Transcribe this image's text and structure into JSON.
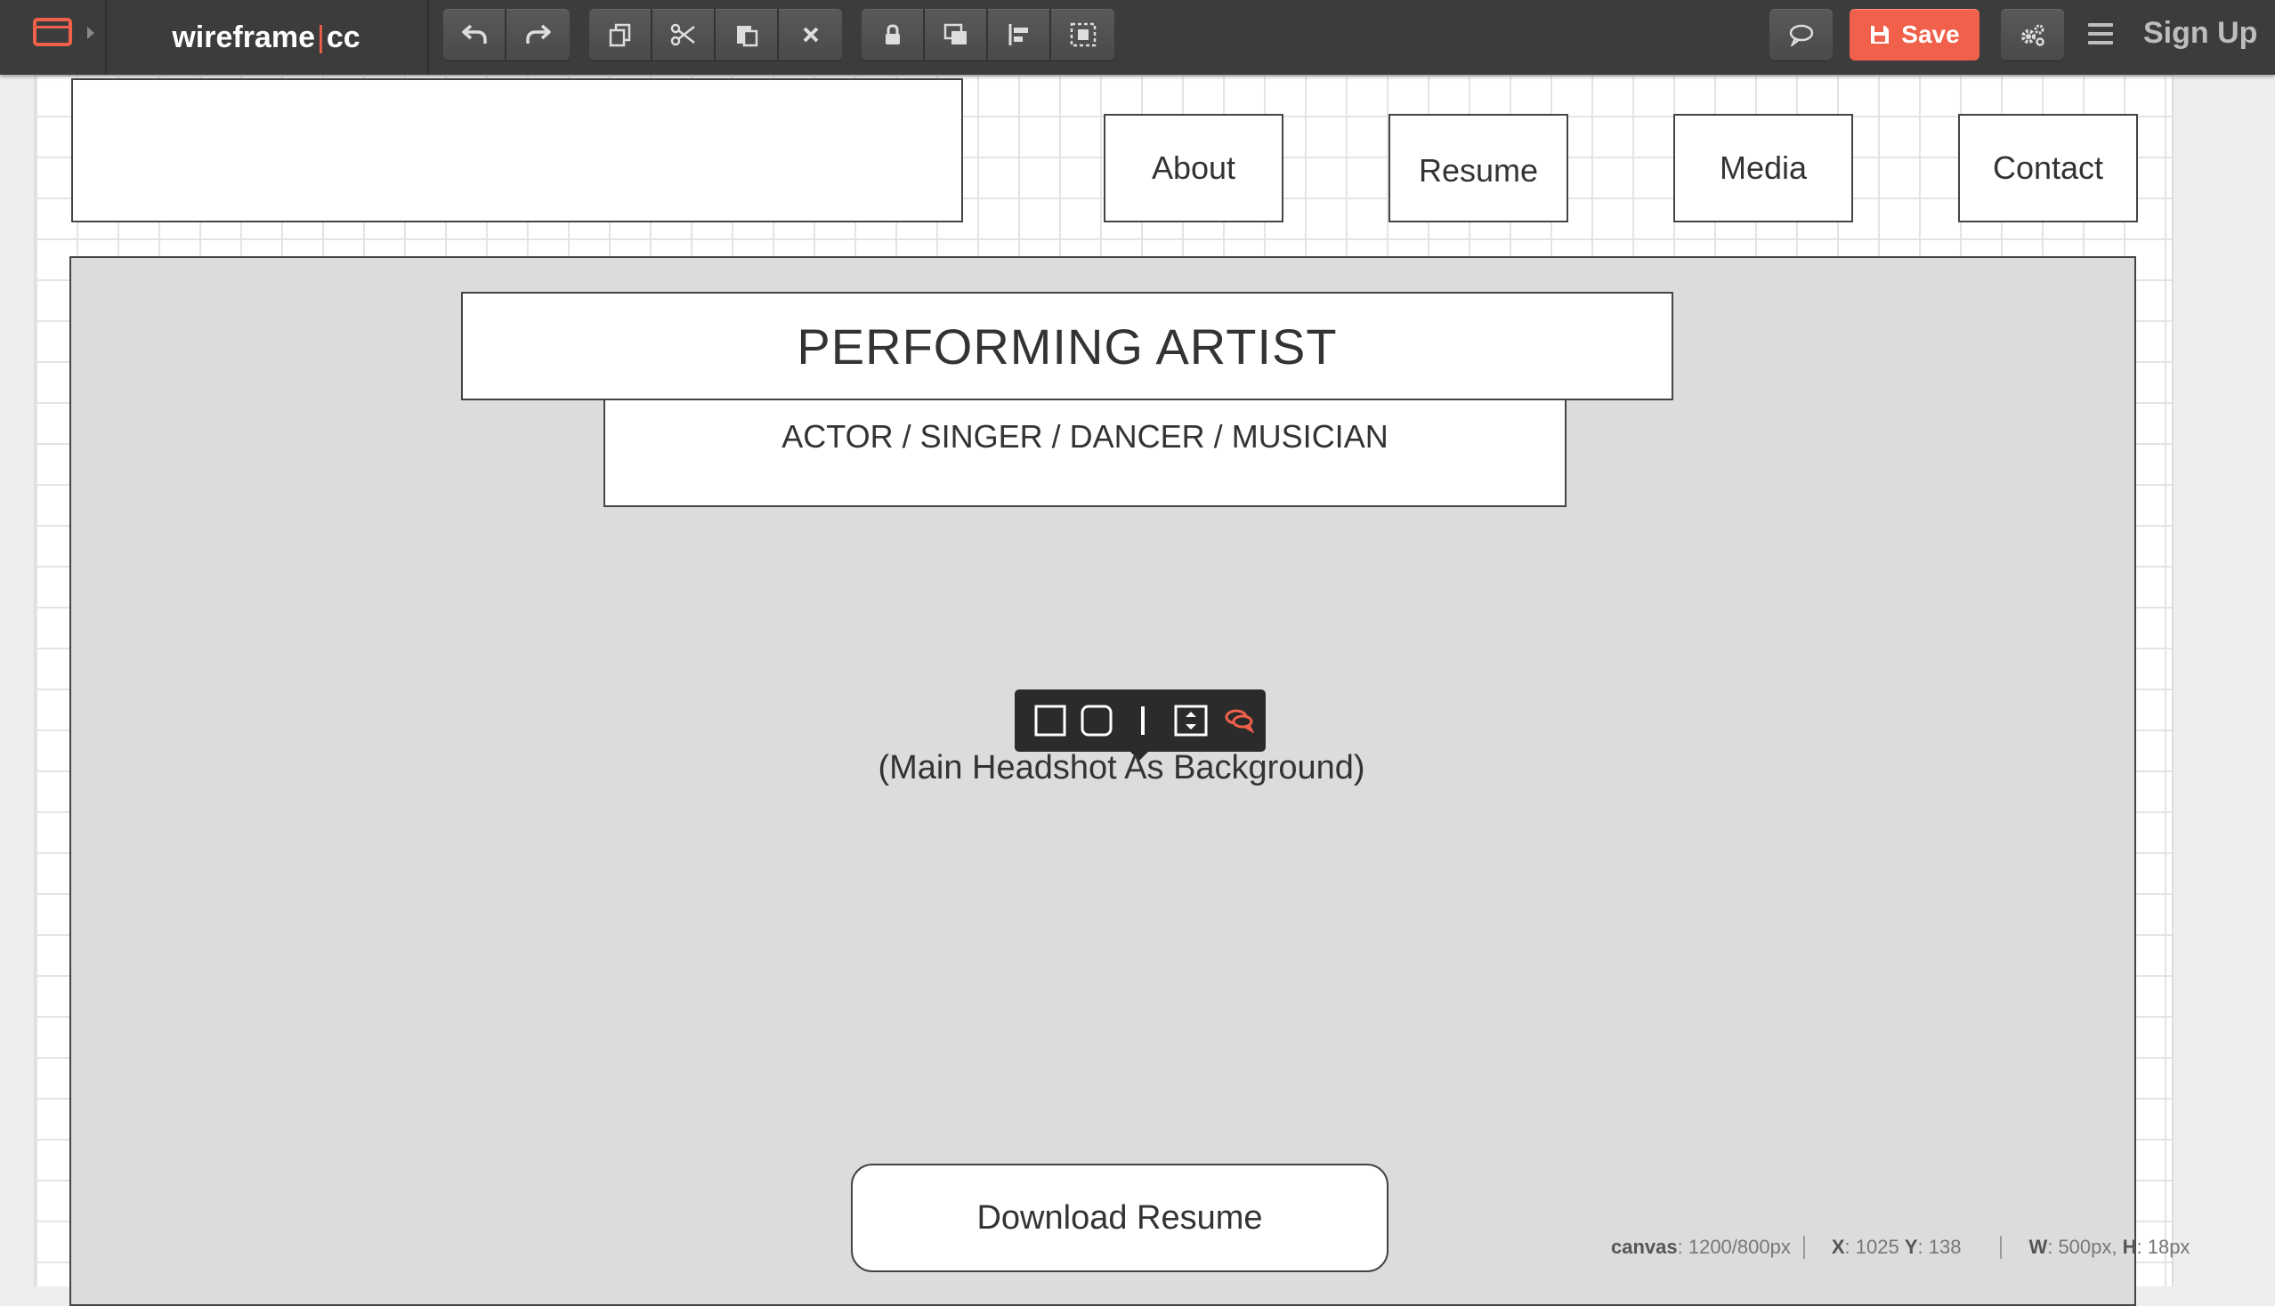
{
  "app": {
    "logo_left": "wireframe",
    "logo_sep": "|",
    "logo_right": "cc",
    "save_label": "Save",
    "signup_label": "Sign Up"
  },
  "toolbar": {
    "history": [
      "undo-icon",
      "redo-icon"
    ],
    "clipboard": [
      "copy-icon",
      "cut-icon",
      "paste-icon",
      "delete-icon"
    ],
    "arrange": [
      "lock-icon",
      "bring-front-icon",
      "align-icon",
      "group-icon"
    ],
    "right": [
      "comment-icon",
      "settings-icon",
      "menu-icon"
    ]
  },
  "nav": {
    "items": [
      "About",
      "Resume",
      "Media",
      "Contact"
    ]
  },
  "hero": {
    "title": "PERFORMING ARTIST",
    "subtitle": "ACTOR / SINGER / DANCER / MUSICIAN",
    "background_note": "(Main Headshot As Background)",
    "download_label": "Download Resume"
  },
  "shape_toolbar": [
    "square-shape-icon",
    "rounded-shape-icon",
    "line-icon",
    "resize-icon",
    "comment-icon"
  ],
  "status": {
    "canvas_label": "canvas",
    "canvas_value": ": 1200/800px",
    "x_label": "X",
    "x_value": ": 1025 ",
    "y_label": "Y",
    "y_value": ": 138",
    "w_label": "W",
    "w_value": ": 500px, ",
    "h_label": "H",
    "h_value": ": 18px"
  },
  "colors": {
    "accent": "#f0604a",
    "toolbar_bg": "#3c3c3c",
    "hero_bg": "#dcdcdc"
  }
}
